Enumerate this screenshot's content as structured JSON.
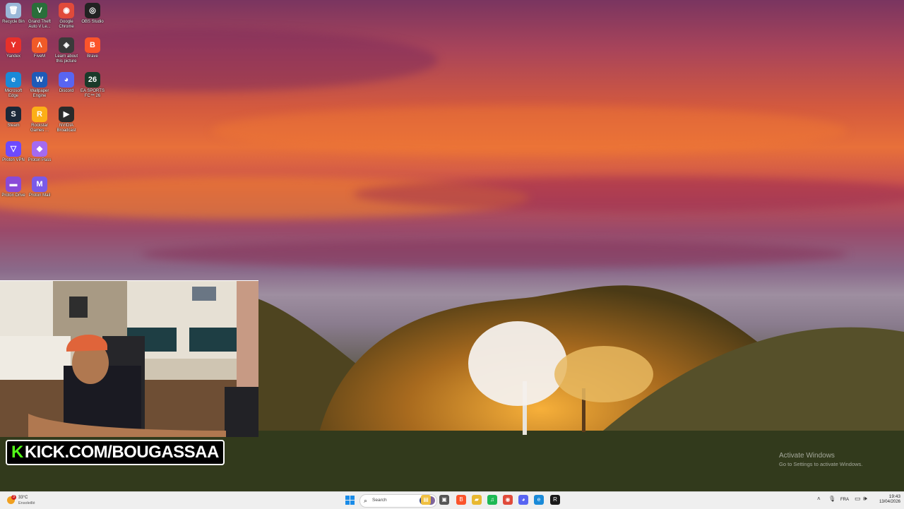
{
  "desktop_icons": [
    {
      "label": "Recycle Bin",
      "icon": "recycle-bin-icon",
      "color": "#9ab8d8",
      "glyph": "🗑"
    },
    {
      "label": "Grand Theft Auto V Le...",
      "icon": "gta-icon",
      "color": "#2a6e3a",
      "glyph": "V"
    },
    {
      "label": "Google Chrome",
      "icon": "chrome-icon",
      "color": "#e04a3a",
      "glyph": "◉"
    },
    {
      "label": "OBS Studio",
      "icon": "obs-icon",
      "color": "#222222",
      "glyph": "◎"
    },
    {
      "label": "Yandex",
      "icon": "yandex-icon",
      "color": "#e8302a",
      "glyph": "Y"
    },
    {
      "label": "FiveM",
      "icon": "fivem-icon",
      "color": "#f05a28",
      "glyph": "Λ"
    },
    {
      "label": "Learn about this picture",
      "icon": "learn-picture-icon",
      "color": "#3a3a3a",
      "glyph": "◈"
    },
    {
      "label": "Brave",
      "icon": "brave-icon",
      "color": "#fb542b",
      "glyph": "B"
    },
    {
      "label": "Microsoft Edge",
      "icon": "edge-icon",
      "color": "#1a8ad8",
      "glyph": "e"
    },
    {
      "label": "Wallpaper Engine",
      "icon": "wallpaper-engine-icon",
      "color": "#1e5ab8",
      "glyph": "W"
    },
    {
      "label": "Discord",
      "icon": "discord-icon",
      "color": "#5865f2",
      "glyph": "◕"
    },
    {
      "label": "EA SPORTS FC™ 26",
      "icon": "ea-fc-icon",
      "color": "#1a3a2a",
      "glyph": "26"
    },
    {
      "label": "Steam",
      "icon": "steam-icon",
      "color": "#1b2838",
      "glyph": "S"
    },
    {
      "label": "Rockstar Games ...",
      "icon": "rockstar-icon",
      "color": "#fcaf17",
      "glyph": "R"
    },
    {
      "label": "NVIDIA Broadcast",
      "icon": "nvidia-broadcast-icon",
      "color": "#2a2a2a",
      "glyph": "▶"
    },
    {
      "label": "Proton VPN",
      "icon": "proton-vpn-icon",
      "color": "#6d4aff",
      "glyph": "▽"
    },
    {
      "label": "Proton Pass",
      "icon": "proton-pass-icon",
      "color": "#a46af0",
      "glyph": "◆"
    },
    {
      "label": "Proton Drive",
      "icon": "proton-drive-icon",
      "color": "#8a4ad8",
      "glyph": "▬"
    },
    {
      "label": "Proton Mail",
      "icon": "proton-mail-icon",
      "color": "#7a5ae8",
      "glyph": "M"
    }
  ],
  "overlay": {
    "kick_k": "K",
    "kick_text": "KICK.COM/BOUGASSAA",
    "accent": "#53fc18"
  },
  "watermark": {
    "title": "Activate Windows",
    "subtitle": "Go to Settings to activate Windows."
  },
  "taskbar": {
    "weather_badge": "3",
    "weather_temp": "33°C",
    "weather_desc": "Ensoleillé",
    "search_placeholder": "Search",
    "pinned": [
      {
        "icon": "file-explorer-icon",
        "color": "#f0c040",
        "glyph": "▤"
      },
      {
        "icon": "task-view-icon",
        "color": "#555555",
        "glyph": "▣"
      },
      {
        "icon": "brave-icon",
        "color": "#fb542b",
        "glyph": "B"
      },
      {
        "icon": "folder-icon",
        "color": "#e8b830",
        "glyph": "▰"
      },
      {
        "icon": "spotify-icon",
        "color": "#1db954",
        "glyph": "♫"
      },
      {
        "icon": "chrome-icon",
        "color": "#e04a3a",
        "glyph": "◉"
      },
      {
        "icon": "discord-icon",
        "color": "#5865f2",
        "glyph": "◕"
      },
      {
        "icon": "edge-icon",
        "color": "#1a8ad8",
        "glyph": "e"
      },
      {
        "icon": "rockstar-launcher-icon",
        "color": "#1a1a1a",
        "glyph": "R"
      }
    ],
    "language": "FRA",
    "time": "19:43",
    "date": "13/04/2026"
  }
}
